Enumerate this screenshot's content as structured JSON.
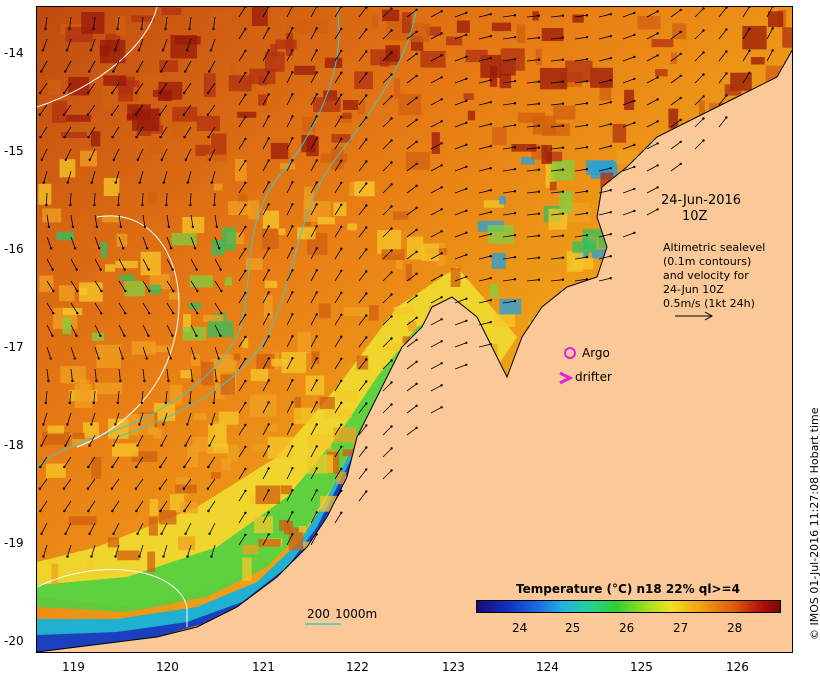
{
  "map": {
    "date_label": "24-Jun-2016",
    "time_label": "10Z",
    "altimetry_lines": [
      "Altimetric sealevel",
      "(0.1m contours)",
      "and velocity for",
      "24-Jun 10Z",
      "0.5m/s (1kt 24h)"
    ],
    "argo_label": "Argo",
    "drifter_label": "drifter",
    "depth_label_200": "200",
    "depth_label_1000": "1000m",
    "credit": "© IMOS 01-Jul-2016 11:27:08 Hobart time",
    "lon_ticks": [
      "119",
      "120",
      "121",
      "122",
      "123",
      "124",
      "125",
      "126"
    ],
    "lat_ticks": [
      "-14",
      "-15",
      "-16",
      "-17",
      "-18",
      "-19",
      "-20"
    ],
    "colorbar": {
      "title": "Temperature (°C) n18 22% ql>=4",
      "ticks": [
        "24",
        "25",
        "26",
        "27",
        "28"
      ]
    },
    "colors": {
      "land": "#fbc898",
      "contour_200": "#40c8c8",
      "sealevel_contour": "#ffffff",
      "argo": "#e020e0",
      "drifter": "#e020e0"
    },
    "icons": {
      "argo": "argo-float-icon",
      "drifter": "drifter-icon",
      "scale_arrow": "velocity-scale-arrow-icon"
    }
  }
}
